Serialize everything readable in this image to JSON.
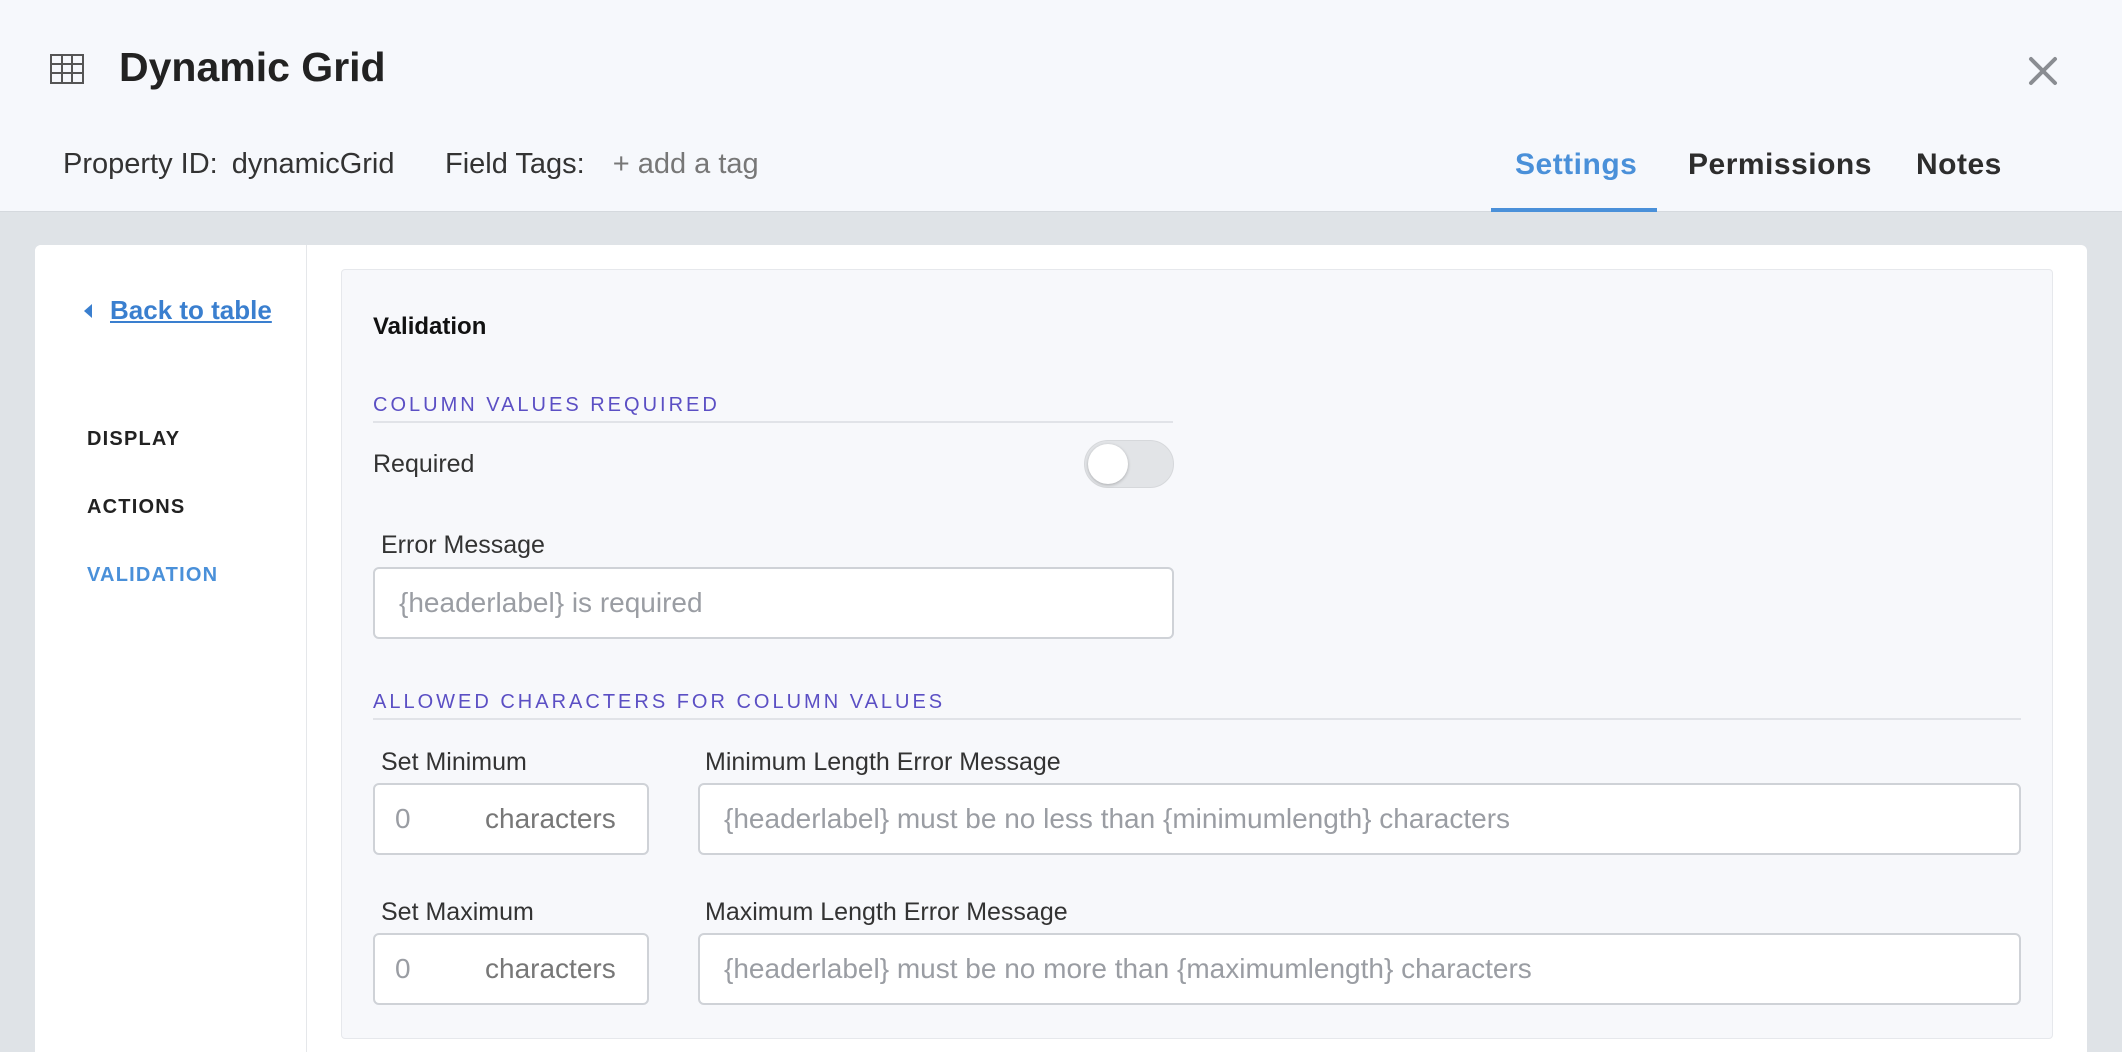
{
  "header": {
    "title": "Dynamic Grid",
    "property_id_label": "Property ID:",
    "property_id_value": "dynamicGrid",
    "field_tags_label": "Field Tags:",
    "add_tag_label": "+ add a tag",
    "tabs": [
      {
        "label": "Settings",
        "active": true
      },
      {
        "label": "Permissions",
        "active": false
      },
      {
        "label": "Notes",
        "active": false
      }
    ]
  },
  "sidebar": {
    "back_label": "Back to table",
    "items": [
      {
        "label": "DISPLAY",
        "active": false
      },
      {
        "label": "ACTIONS",
        "active": false
      },
      {
        "label": "VALIDATION",
        "active": true
      }
    ]
  },
  "content": {
    "section_title": "Validation",
    "required_group": {
      "heading": "COLUMN VALUES REQUIRED",
      "required_label": "Required",
      "required_on": false,
      "error_label": "Error Message",
      "error_placeholder": "{headerlabel} is required"
    },
    "chars_group": {
      "heading": "ALLOWED CHARACTERS FOR COLUMN VALUES",
      "min_label": "Set Minimum",
      "min_placeholder": "0",
      "min_suffix": "characters",
      "min_error_label": "Minimum Length Error Message",
      "min_error_placeholder": "{headerlabel} must be no less than {minimumlength} characters",
      "max_label": "Set Maximum",
      "max_placeholder": "0",
      "max_suffix": "characters",
      "max_error_label": "Maximum Length Error Message",
      "max_error_placeholder": "{headerlabel} must be no more than {maximumlength} characters"
    }
  },
  "colors": {
    "accent": "#4a90d9",
    "heading_purple": "#5b4fc4"
  }
}
